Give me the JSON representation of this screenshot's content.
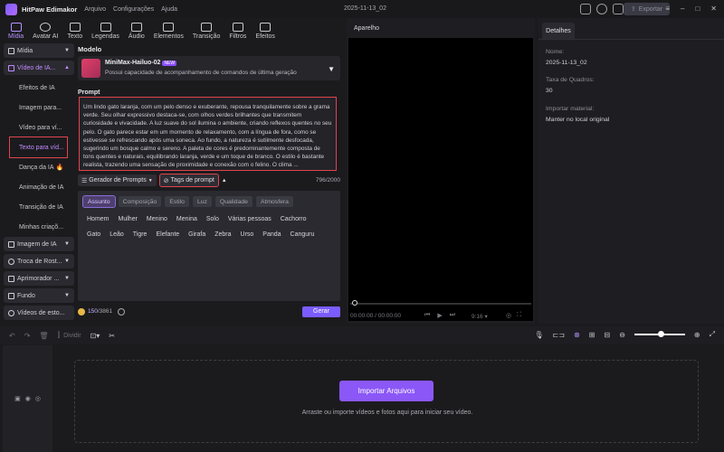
{
  "titlebar": {
    "app_name": "HitPaw Edimakor",
    "menu": [
      "Arquivo",
      "Configurações",
      "Ajuda"
    ],
    "project_title": "2025-11-13_02",
    "export_label": "Exportar"
  },
  "toolbar": {
    "tools": [
      "Mídia",
      "Avatar AI",
      "Texto",
      "Legendas",
      "Áudio",
      "Elementos",
      "Transição",
      "Filtros",
      "Efeitos"
    ],
    "active": "Mídia"
  },
  "leftnav": {
    "media": "Mídia",
    "video_ia": "Vídeo de IA...",
    "sub": [
      "Efeitos de IA",
      "Imagem para...",
      "Vídeo para ví...",
      "Texto para víd...",
      "Dança da IA",
      "Animação de IA",
      "Transição de IA",
      "Minhas criaçõ..."
    ],
    "selected_sub": "Texto para víd...",
    "sections": [
      "Imagem de IA",
      "Troca de Rost...",
      "Aprimorador ...",
      "Fundo",
      "Vídeos de esto..."
    ]
  },
  "model": {
    "label": "Modelo",
    "name": "MiniMax-Hailuo-02",
    "badge": "NEW",
    "description": "Possui capacidade de acompanhamento de comandos de última geração"
  },
  "prompt": {
    "label": "Prompt",
    "text": "Um lindo gato laranja, com um pelo denso e exuberante, repousa tranquilamente sobre a grama verde. Seu olhar expressivo destaca-se, com olhos verdes brilhantes que transmitem curiosidade e vivacidade. A luz suave do sol ilumina o ambiente, criando reflexos quentes no seu pelo. O gato parece estar em um momento de relaxamento, com a língua de fora, como se estivesse se refrescando após uma soneca. Ao fundo, a natureza é sutilmente desfocada, sugerindo um bosque calmo e sereno. A paleta de cores é predominantemente composta de tons quentes e naturais, equilibrando laranja, verde e um toque de branco. O estilo é bastante realista, trazendo uma sensação de proximidade e conexão com o felino. O clima ...",
    "generator_btn": "Gerador de Prompts",
    "tags_btn": "Tags de prompt",
    "counter": "796/2000"
  },
  "tags": {
    "tabs": [
      "Assunto",
      "Composição",
      "Estilo",
      "Luz",
      "Qualidade",
      "Atmosfera"
    ],
    "active_tab": "Assunto",
    "words": [
      "Homem",
      "Mulher",
      "Menino",
      "Menina",
      "Solo",
      "Várias pessoas",
      "Cachorro",
      "Gato",
      "Leão",
      "Tigre",
      "Elefante",
      "Girafa",
      "Zebra",
      "Urso",
      "Panda",
      "Canguru"
    ]
  },
  "generate": {
    "credits_used": "150",
    "credits_total": "/3861",
    "button": "Gerar"
  },
  "player": {
    "label": "Aparelho",
    "time": "00:00:00 / 00:00:00",
    "ratio": "9:16"
  },
  "details": {
    "tab": "Detalhes",
    "name_label": "Nome:",
    "name_value": "2025-11-13_02",
    "fps_label": "Taxa de Quadros:",
    "fps_value": "30",
    "import_label": "Importar material:",
    "import_value": "Manter no local original"
  },
  "timeline": {
    "divide": "Dividir",
    "import_button": "Importar Arquivos",
    "drop_text": "Arraste ou importe vídeos e fotos aqui para iniciar seu vídeo.",
    "zoom_percent": 50
  },
  "colors": {
    "accent": "#8b57f7",
    "highlight_border": "#e0444e"
  }
}
